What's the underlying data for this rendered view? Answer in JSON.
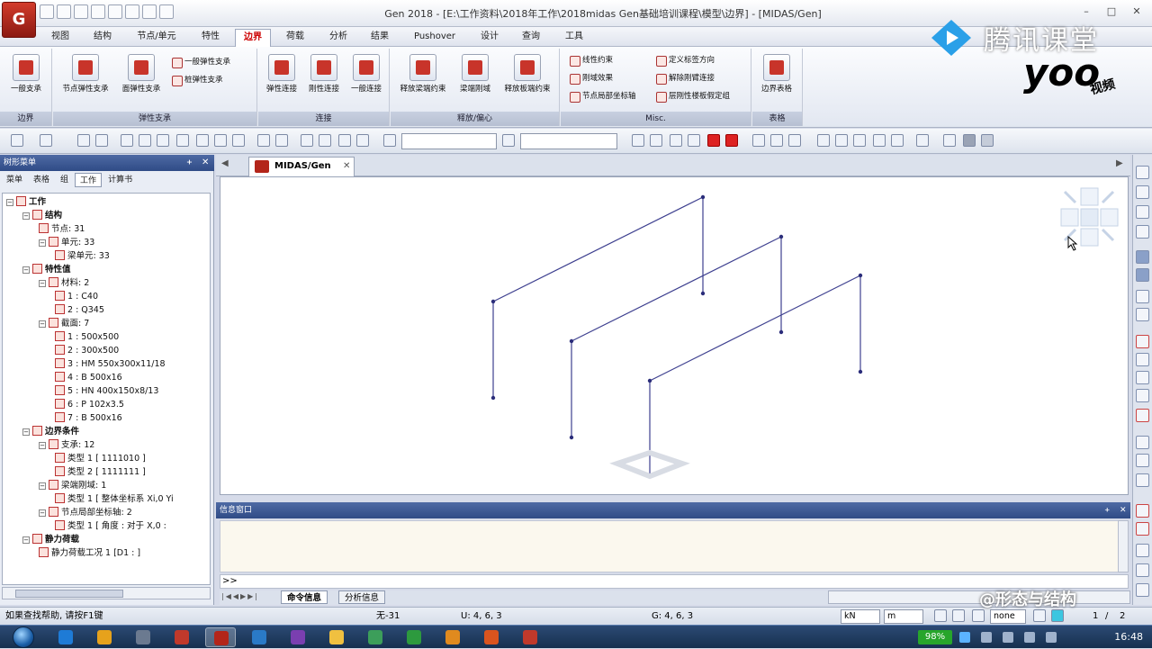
{
  "window": {
    "title": "Gen 2018 - [E:\\工作资料\\2018年工作\\2018midas Gen基础培训课程\\模型\\边界] - [MIDAS/Gen]",
    "app_logo": "G",
    "controls": [
      "–",
      "□",
      "✕"
    ]
  },
  "watermark": {
    "brand": "腾讯课堂",
    "logo": "yoo",
    "sub": "视频"
  },
  "menu": {
    "tabs": [
      "视图",
      "结构",
      "节点/单元",
      "特性",
      "边界",
      "荷载",
      "分析",
      "结果",
      "Pushover",
      "设计",
      "查询",
      "工具"
    ],
    "active": "边界"
  },
  "ribbon": {
    "groups": [
      {
        "title": "边界",
        "buttons": [
          "一般支承"
        ]
      },
      {
        "title": "弹性支承",
        "buttons": [
          "节点弹性支承",
          "面弹性支承"
        ],
        "small": [
          "一般弹性支承",
          "桩弹性支承"
        ]
      },
      {
        "title": "连接",
        "buttons": [
          "弹性连接",
          "刚性连接",
          "一般连接"
        ]
      },
      {
        "title": "释放/偏心",
        "buttons": [
          "释放梁端约束",
          "梁端刚域",
          "释放板端约束"
        ]
      },
      {
        "title": "Misc.",
        "small": [
          "线性约束",
          "刚域效果",
          "节点局部坐标轴",
          "定义标签方向",
          "解除刚臂连接",
          "层刚性楼板假定组"
        ]
      },
      {
        "title": "表格",
        "buttons": [
          "边界表格"
        ]
      }
    ]
  },
  "left_panel": {
    "header": "树形菜单",
    "tabs": [
      "菜单",
      "表格",
      "组",
      "工作",
      "计算书"
    ],
    "active_tab": "工作",
    "tree": [
      {
        "level": 0,
        "text": "工作"
      },
      {
        "level": 1,
        "text": "结构"
      },
      {
        "level": 2,
        "text": "节点: 31"
      },
      {
        "level": 2,
        "text": "单元: 33"
      },
      {
        "level": 3,
        "text": "梁单元: 33"
      },
      {
        "level": 1,
        "text": "特性值"
      },
      {
        "level": 2,
        "text": "材料: 2"
      },
      {
        "level": 3,
        "text": "1 : C40"
      },
      {
        "level": 3,
        "text": "2 : Q345"
      },
      {
        "level": 2,
        "text": "截面: 7"
      },
      {
        "level": 3,
        "text": "1 : 500x500"
      },
      {
        "level": 3,
        "text": "2 : 300x500"
      },
      {
        "level": 3,
        "text": "3 : HM 550x300x11/18"
      },
      {
        "level": 3,
        "text": "4 : B 500x16"
      },
      {
        "level": 3,
        "text": "5 : HN 400x150x8/13"
      },
      {
        "level": 3,
        "text": "6 : P 102x3.5"
      },
      {
        "level": 3,
        "text": "7 : B 500x16"
      },
      {
        "level": 1,
        "text": "边界条件"
      },
      {
        "level": 2,
        "text": "支承: 12"
      },
      {
        "level": 3,
        "text": "类型 1 [ 1111010 ]"
      },
      {
        "level": 3,
        "text": "类型 2 [ 1111111 ]"
      },
      {
        "level": 2,
        "text": "梁端刚域: 1"
      },
      {
        "level": 3,
        "text": "类型 1 [ 整体坐标系 Xi,0 Yi"
      },
      {
        "level": 2,
        "text": "节点局部坐标轴: 2"
      },
      {
        "level": 3,
        "text": "类型 1 [ 角度 : 对于 X,0 : "
      },
      {
        "level": 1,
        "text": "静力荷载"
      },
      {
        "level": 2,
        "text": "静力荷载工况 1 [D1 : ]"
      }
    ]
  },
  "view": {
    "tab_label": "MIDAS/Gen",
    "frames": [
      {
        "top": [
          [
            547,
            334
          ],
          [
            780,
            218
          ]
        ],
        "col1": [
          [
            547,
            334
          ],
          [
            547,
            441
          ]
        ],
        "col2": [
          [
            780,
            218
          ],
          [
            780,
            325
          ]
        ]
      },
      {
        "top": [
          [
            634,
            378
          ],
          [
            867,
            262
          ]
        ],
        "col1": [
          [
            634,
            378
          ],
          [
            634,
            485
          ]
        ],
        "col2": [
          [
            867,
            262
          ],
          [
            867,
            368
          ]
        ]
      },
      {
        "top": [
          [
            721,
            422
          ],
          [
            955,
            305
          ]
        ],
        "col1": [
          [
            721,
            422
          ],
          [
            721,
            527
          ]
        ],
        "col2": [
          [
            955,
            305
          ],
          [
            955,
            412
          ]
        ]
      }
    ]
  },
  "message": {
    "header": "信息窗口",
    "prompt": ">>",
    "tabs": [
      "命令信息",
      "分析信息"
    ]
  },
  "status": {
    "help": "如果查找帮助, 请按F1键",
    "node": "无-31",
    "u_coord": "U: 4, 6, 3",
    "g_coord": "G: 4, 6, 3",
    "force_unit": "kN",
    "length_unit": "m",
    "filter": "none",
    "page": "1",
    "page_total": "2"
  },
  "brandmark": "@形态与结构",
  "taskbar": {
    "battery": "98%",
    "clock": "16:48",
    "apps": [
      "#1e7bd6",
      "#e6a21c",
      "#6b7a90",
      "#c0392b",
      "#b3251a",
      "#2a7ac7",
      "#7a3fb0",
      "#f0c040",
      "#3c9e5a",
      "#2d9a3e",
      "#e08a1e",
      "#d9541e",
      "#c0392b"
    ]
  }
}
